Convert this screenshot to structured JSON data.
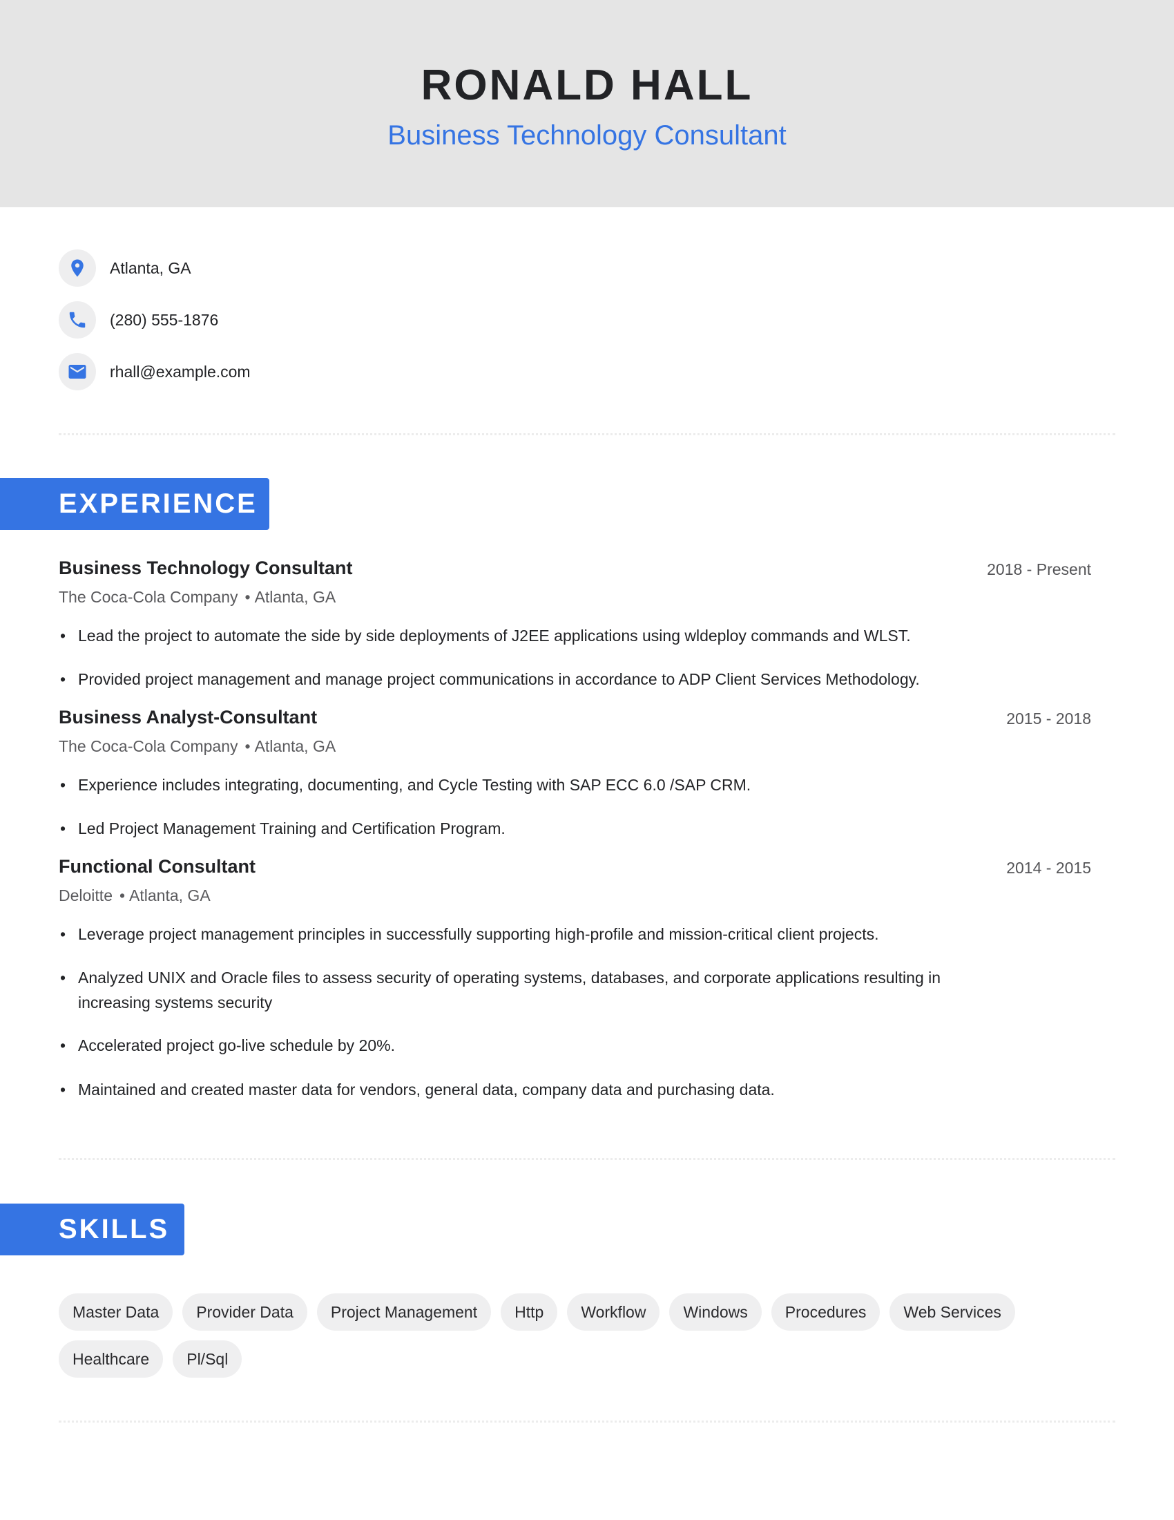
{
  "header": {
    "name": "RONALD HALL",
    "title": "Business Technology Consultant"
  },
  "contact": [
    {
      "icon": "location-pin-icon",
      "text": "Atlanta, GA"
    },
    {
      "icon": "phone-icon",
      "text": "(280) 555-1876"
    },
    {
      "icon": "email-icon",
      "text": "rhall@example.com"
    }
  ],
  "colors": {
    "accent": "#3574e3",
    "header_bg": "#e5e5e5",
    "chip_bg": "#efeff0"
  },
  "experience": {
    "heading": "EXPERIENCE",
    "jobs": [
      {
        "title": "Business Technology Consultant",
        "dates": "2018 - Present",
        "company": "The Coca-Cola Company",
        "location": "Atlanta, GA",
        "bullets": [
          "Lead the project to automate the side by side deployments of J2EE applications using wldeploy commands and WLST.",
          "Provided project management and manage project communications in accordance to ADP Client Services Methodology."
        ]
      },
      {
        "title": "Business Analyst-Consultant",
        "dates": "2015 - 2018",
        "company": "The Coca-Cola Company",
        "location": "Atlanta, GA",
        "bullets": [
          "Experience includes integrating, documenting, and Cycle Testing with SAP ECC 6.0 /SAP CRM.",
          "Led Project Management Training and Certification Program."
        ]
      },
      {
        "title": "Functional Consultant",
        "dates": "2014 - 2015",
        "company": "Deloitte",
        "location": "Atlanta, GA",
        "bullets": [
          "Leverage project management principles in successfully supporting high-profile and mission-critical client projects.",
          "Analyzed UNIX and Oracle files to assess security of operating systems, databases, and corporate applications resulting in increasing systems security",
          "Accelerated project go-live schedule by 20%.",
          "Maintained and created master data for vendors, general data, company data and purchasing data."
        ]
      }
    ]
  },
  "skills": {
    "heading": "SKILLS",
    "items": [
      "Master Data",
      "Provider Data",
      "Project Management",
      "Http",
      "Workflow",
      "Windows",
      "Procedures",
      "Web Services",
      "Healthcare",
      "Pl/Sql"
    ]
  }
}
